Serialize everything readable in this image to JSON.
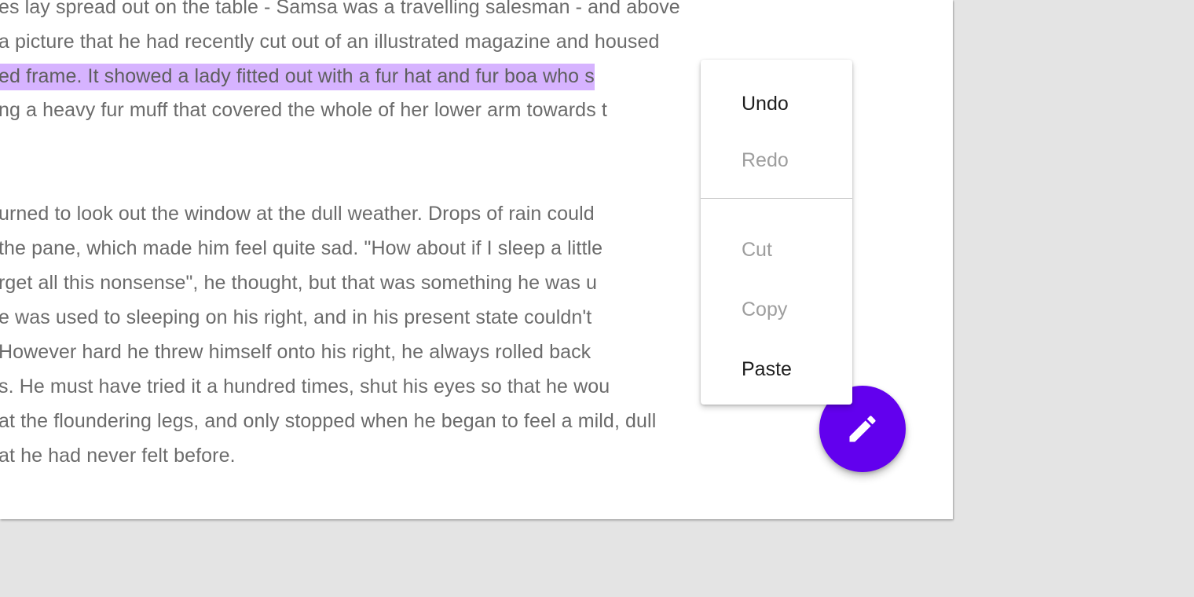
{
  "colors": {
    "background": "#e4e4e4",
    "page": "#ffffff",
    "text": "#6b6b6b",
    "selection": "#d6b3ff",
    "fab": "#6200ee",
    "menu_enabled_text": "#1f1f1f",
    "menu_disabled_text": "#9e9e9e"
  },
  "document": {
    "paragraph1": {
      "lines": [
        "es lay spread out on the table - Samsa was a travelling salesman - and above",
        "a picture that he had recently cut out of an illustrated magazine and housed",
        "ed frame. It showed a lady fitted out with a fur hat and fur boa who s",
        "ng a heavy fur muff that covered the whole of her lower arm towards t"
      ]
    },
    "paragraph2": {
      "lines": [
        "urned to look out the window at the dull weather. Drops of rain could",
        "the pane, which made him feel quite sad. \"How about if I sleep a little",
        "rget all this nonsense\", he thought, but that was something he was u",
        "e was used to sleeping on his right, and in his present state couldn't",
        " However hard he threw himself onto his right, he always rolled back",
        "s. He must have tried it a hundred times, shut his eyes so that he wou",
        "at the floundering legs, and only stopped when he began to feel a mild, dull",
        "at he had never felt before."
      ]
    }
  },
  "context_menu": {
    "undo": "Undo",
    "redo": "Redo",
    "cut": "Cut",
    "copy": "Copy",
    "paste": "Paste"
  },
  "fab": {
    "icon": "pencil-icon"
  }
}
